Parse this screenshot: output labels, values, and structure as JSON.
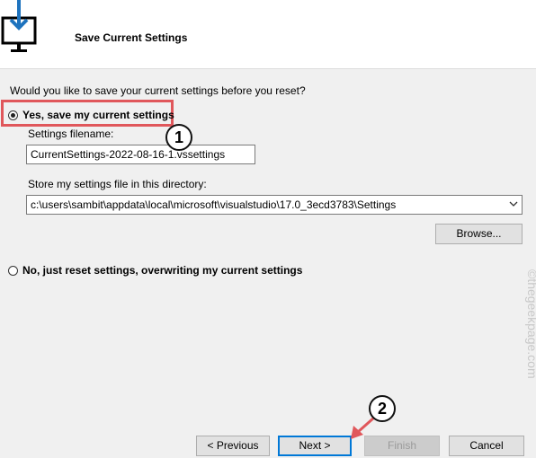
{
  "header": {
    "title": "Save Current Settings",
    "icon": "monitor-download-icon"
  },
  "question": "Would you like to save your current settings before you reset?",
  "option_yes": {
    "label": "Yes, save my current settings",
    "selected": true
  },
  "settings_filename": {
    "label": "Settings filename:",
    "value": "CurrentSettings-2022-08-16-1.vssettings"
  },
  "directory": {
    "label": "Store my settings file in this directory:",
    "value": "c:\\users\\sambit\\appdata\\local\\microsoft\\visualstudio\\17.0_3ecd3783\\Settings"
  },
  "browse_label": "Browse...",
  "option_no": {
    "label": "No, just reset settings, overwriting my current settings",
    "selected": false
  },
  "buttons": {
    "previous": "< Previous",
    "next": "Next >",
    "finish": "Finish",
    "cancel": "Cancel"
  },
  "annotations": {
    "badge1": "1",
    "badge2": "2",
    "accent": "#e0575b"
  },
  "watermark": "©thegeekpage.com"
}
